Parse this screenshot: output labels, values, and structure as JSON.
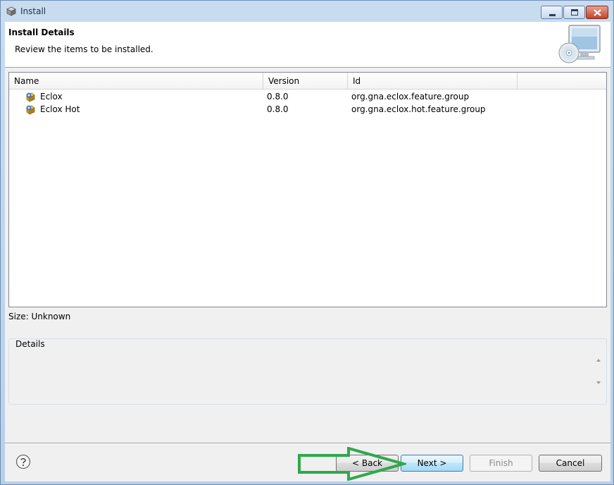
{
  "window": {
    "title": "Install"
  },
  "header": {
    "title": "Install Details",
    "description": "Review the items to be installed."
  },
  "table": {
    "columns": [
      "Name",
      "Version",
      "Id"
    ],
    "rows": [
      {
        "name": "Eclox",
        "version": "0.8.0",
        "id": "org.gna.eclox.feature.group"
      },
      {
        "name": "Eclox Hot",
        "version": "0.8.0",
        "id": "org.gna.eclox.hot.feature.group"
      }
    ]
  },
  "size_label": "Size: Unknown",
  "details": {
    "label": "Details"
  },
  "buttons": {
    "back": "< Back",
    "next": "Next >",
    "finish": "Finish",
    "cancel": "Cancel"
  },
  "icons": {
    "window": "install-cube-icon",
    "header": "computer-cd-icon",
    "row": "feature-plugin-icon",
    "help": "help-question-icon"
  },
  "colors": {
    "annotation_arrow": "#2fa84a",
    "title_bar": "#bcd3ea",
    "close_button": "#c2442c"
  }
}
